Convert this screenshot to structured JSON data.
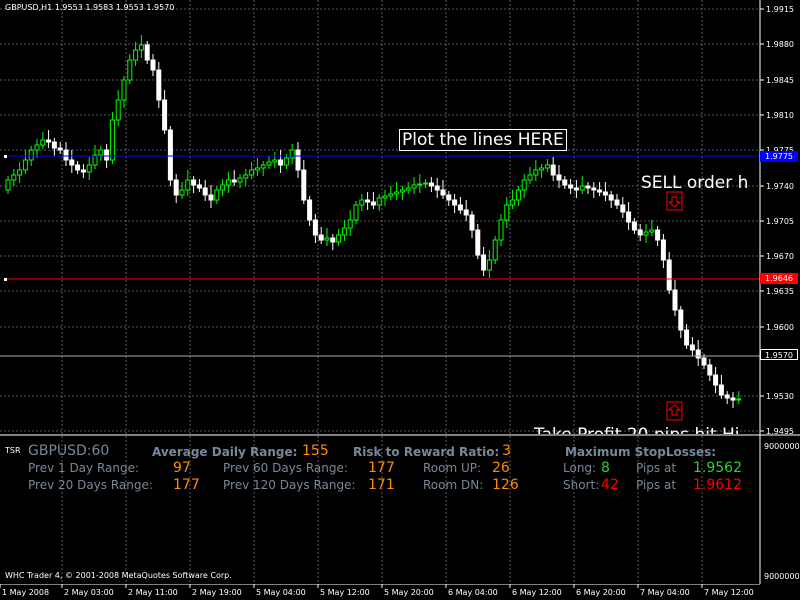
{
  "chart": {
    "symbol_header": "GBPUSD,H1  1.9553 1.9583 1.9553 1.9570",
    "plot_lines_label": "Plot the lines HERE",
    "sell_order_text": "SELL order h",
    "take_profit_text": "Take Profit 20 pips hit Hi",
    "price_axis": [
      "1.9915",
      "1.9880",
      "1.9845",
      "1.9810",
      "1.9775",
      "1.9740",
      "1.9705",
      "1.9670",
      "1.9635",
      "1.9600",
      "1.9570",
      "1.9530",
      "1.9495"
    ],
    "blue_line_price": "1.9775",
    "red_line_price": "1.9646",
    "current_price": "1.9570",
    "colors": {
      "blue_line": "#0000ff",
      "red_line": "#ff0000",
      "bull": "#00ff00",
      "bear": "#ffffff",
      "grid": "#5a5a5a"
    }
  },
  "indicator": {
    "name": "TSR",
    "symbol": "GBPUSD:60",
    "axis_top": "9000000",
    "axis_bottom": "9000000",
    "avg_daily_range_label": "Average Daily Range:",
    "avg_daily_range": "155",
    "rr_label": "Risk to Reward Ratio:",
    "rr_value": "3",
    "max_sl_label": "Maximum StopLosses:",
    "prev1_label": "Prev 1 Day Range:",
    "prev1_value": "97",
    "prev60_label": "Prev 60 Days Range:",
    "prev60_value": "177",
    "room_up_label": "Room UP:",
    "room_up_value": "26",
    "long_label": "Long:",
    "long_value": "8",
    "pips_at_label_1": "Pips at",
    "long_pips": "1.9562",
    "prev20_label": "Prev 20 Days Range:",
    "prev20_value": "177",
    "prev120_label": "Prev 120 Days Range:",
    "prev120_value": "171",
    "room_dn_label": "Room DN:",
    "room_dn_value": "126",
    "short_label": "Short:",
    "short_value": "42",
    "pips_at_label_2": "Pips at",
    "short_pips": "1.9612",
    "copyright": "WHC Trader 4, © 2001-2008 MetaQuotes Software Corp."
  },
  "time_axis": [
    "1 May 2008",
    "2 May 03:00",
    "2 May 11:00",
    "2 May 19:00",
    "5 May 04:00",
    "5 May 12:00",
    "5 May 20:00",
    "6 May 04:00",
    "6 May 12:00",
    "6 May 20:00",
    "7 May 04:00",
    "7 May 12:00"
  ]
}
